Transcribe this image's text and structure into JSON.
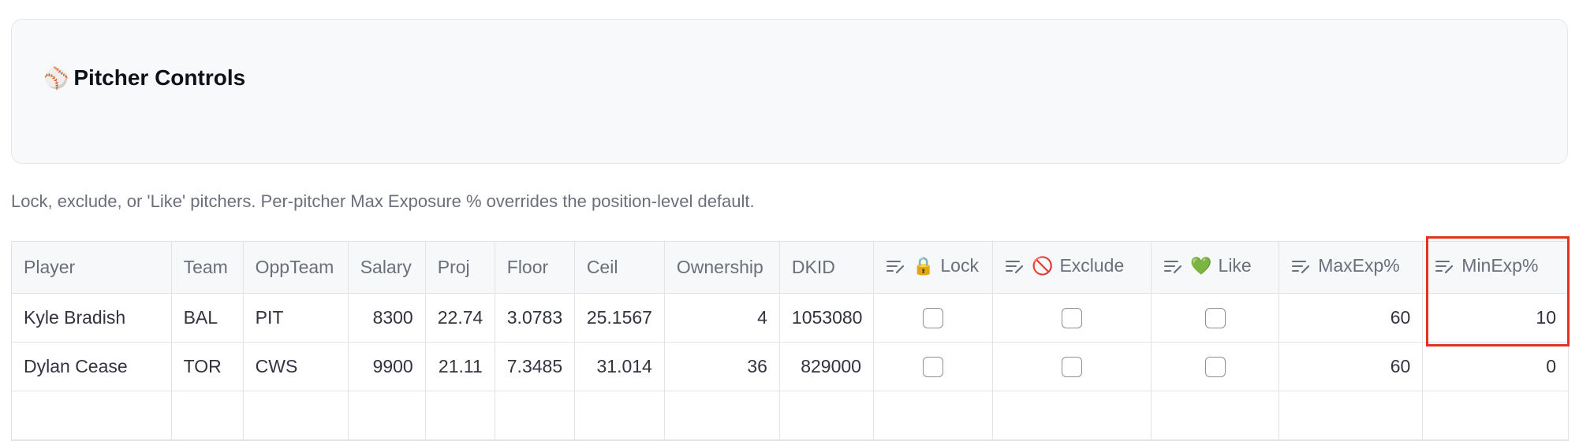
{
  "panel": {
    "icon": "baseball-icon",
    "icon_glyph": "⚾",
    "title": "Pitcher Controls"
  },
  "caption": "Lock, exclude, or 'Like' pitchers. Per-pitcher Max Exposure % overrides the position-level default.",
  "table": {
    "columns": [
      {
        "label": "Player",
        "editable": false
      },
      {
        "label": "Team",
        "editable": false
      },
      {
        "label": "OppTeam",
        "editable": false
      },
      {
        "label": "Salary",
        "editable": false
      },
      {
        "label": "Proj",
        "editable": false
      },
      {
        "label": "Floor",
        "editable": false
      },
      {
        "label": "Ceil",
        "editable": false
      },
      {
        "label": "Ownership",
        "editable": false
      },
      {
        "label": "DKID",
        "editable": false
      },
      {
        "label": "Lock",
        "editable": true,
        "icon": "lock-icon",
        "glyph": "🔒"
      },
      {
        "label": "Exclude",
        "editable": true,
        "icon": "prohibited-icon",
        "glyph": "🚫"
      },
      {
        "label": "Like",
        "editable": true,
        "icon": "green-heart-icon",
        "glyph": "💚"
      },
      {
        "label": "MaxExp%",
        "editable": true
      },
      {
        "label": "MinExp%",
        "editable": true
      }
    ],
    "rows": [
      {
        "player": "Kyle Bradish",
        "team": "BAL",
        "opp": "PIT",
        "salary": "8300",
        "proj": "22.74",
        "floor": "3.0783",
        "ceil": "25.1567",
        "ownership": "4",
        "dkid": "1053080",
        "lock": false,
        "exclude": false,
        "like": false,
        "maxexp": "60",
        "minexp": "10"
      },
      {
        "player": "Dylan Cease",
        "team": "TOR",
        "opp": "CWS",
        "salary": "9900",
        "proj": "21.11",
        "floor": "7.3485",
        "ceil": "31.014",
        "ownership": "36",
        "dkid": "829000",
        "lock": false,
        "exclude": false,
        "like": false,
        "maxexp": "60",
        "minexp": "0"
      }
    ]
  },
  "colors": {
    "highlight": "#e3321f",
    "panel_bg": "#f8f9fb"
  }
}
